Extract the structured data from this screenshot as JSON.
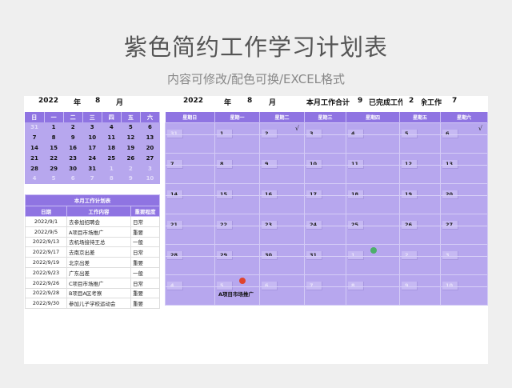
{
  "title": "紫色简约工作学习计划表",
  "subtitle": "内容可修改/配色可换/EXCEL格式",
  "mini_header": {
    "year": "2022",
    "year_unit": "年",
    "month": "8",
    "month_unit": "月"
  },
  "big_header": {
    "year": "2022",
    "year_unit": "年",
    "month": "8",
    "month_unit": "月",
    "total_label": "本月工作合计",
    "total": "9",
    "done_label": "已完成工作",
    "done": "2",
    "remain_label": "剩余工作",
    "remain": "7"
  },
  "mini_calendar": {
    "weekdays": [
      "日",
      "一",
      "二",
      "三",
      "四",
      "五",
      "六"
    ],
    "weeks": [
      [
        "31",
        "1",
        "2",
        "3",
        "4",
        "5",
        "6"
      ],
      [
        "7",
        "8",
        "9",
        "10",
        "11",
        "12",
        "13"
      ],
      [
        "14",
        "15",
        "16",
        "17",
        "18",
        "19",
        "20"
      ],
      [
        "21",
        "22",
        "23",
        "24",
        "25",
        "26",
        "27"
      ],
      [
        "28",
        "29",
        "30",
        "31",
        "1",
        "2",
        "3"
      ],
      [
        "4",
        "5",
        "6",
        "7",
        "8",
        "9",
        "10"
      ]
    ],
    "other_month": [
      [
        0
      ],
      [],
      [],
      [],
      [
        4,
        5,
        6
      ],
      [
        0,
        1,
        2,
        3,
        4,
        5,
        6
      ]
    ]
  },
  "plan": {
    "title": "本月工作计划表",
    "columns": [
      "日期",
      "工作内容",
      "重要程度"
    ],
    "rows": [
      [
        "2022/9/1",
        "去参加招聘会",
        "日常"
      ],
      [
        "2022/9/5",
        "A项目市场推广",
        "重要"
      ],
      [
        "2022/9/13",
        "去机场接待王总",
        "一般"
      ],
      [
        "2022/9/17",
        "去南京出差",
        "日常"
      ],
      [
        "2022/9/19",
        "北京出差",
        "重要"
      ],
      [
        "2022/9/23",
        "广东出差",
        "一般"
      ],
      [
        "2022/9/26",
        "C项目市场推广",
        "日常"
      ],
      [
        "2022/9/28",
        "B项目A区考察",
        "重要"
      ],
      [
        "2022/9/30",
        "参加儿子学校运动会",
        "重要"
      ]
    ]
  },
  "big_calendar": {
    "weekdays": [
      "星期日",
      "星期一",
      "星期二",
      "星期三",
      "星期四",
      "星期五",
      "星期六"
    ],
    "marks": {
      "0-2": "√",
      "0-6": "√"
    },
    "dots": {
      "4-4": "#4caf6a",
      "5-1": "#e0442c"
    },
    "notes": {
      "5-1": "A项目市场推广"
    }
  },
  "colors": {
    "header": "#8f74e2",
    "cell": "#b7a7ee",
    "green_dot": "#4caf6a",
    "red_dot": "#e0442c"
  }
}
